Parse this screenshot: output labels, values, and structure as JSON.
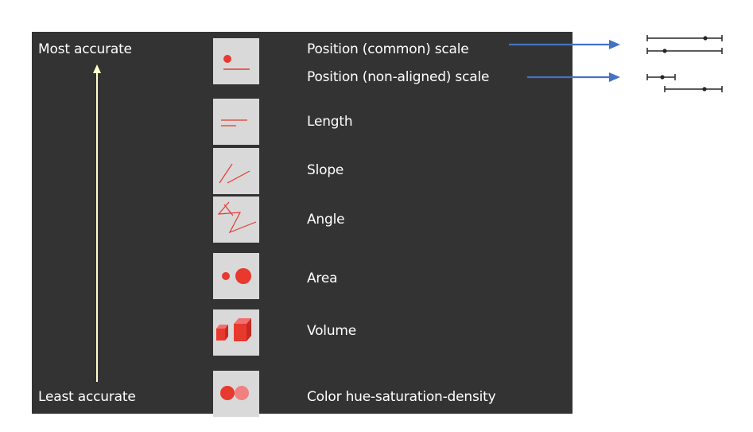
{
  "scale_labels": {
    "most": "Most accurate",
    "least": "Least accurate"
  },
  "encodings": [
    {
      "label": "Position (common) scale",
      "icon": "position-common-icon"
    },
    {
      "label": "Position (non-aligned) scale",
      "icon": "position-nonaligned-icon"
    },
    {
      "label": "Length",
      "icon": "length-icon"
    },
    {
      "label": "Slope",
      "icon": "slope-icon"
    },
    {
      "label": "Angle",
      "icon": "angle-icon"
    },
    {
      "label": "Area",
      "icon": "area-icon"
    },
    {
      "label": "Volume",
      "icon": "volume-icon"
    },
    {
      "label": "Color hue-saturation-density",
      "icon": "color-icon"
    }
  ],
  "colors": {
    "slide_background": "#333333",
    "tile_background": "#d9d9d9",
    "icon_red": "#e8392f",
    "icon_light_red": "#f28080",
    "accuracy_arrow": "#ffffcc",
    "pointer_arrow": "#4472c4",
    "example_lines": "#262626"
  }
}
